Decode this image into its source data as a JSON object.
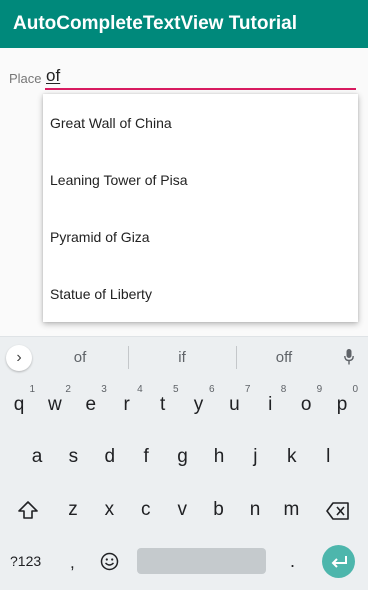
{
  "app": {
    "title": "AutoCompleteTextView Tutorial",
    "accent": "#00897b",
    "underline": "#d81b60"
  },
  "form": {
    "place_label": "Place",
    "place_value": "of"
  },
  "suggestions": [
    "Great Wall of China",
    "Leaning Tower of Pisa",
    "Pyramid of Giza",
    "Statue of Liberty"
  ],
  "keyboard": {
    "strip": {
      "words": [
        "of",
        "if",
        "off"
      ],
      "arrow_icon": "chevron-right-icon",
      "mic_icon": "mic-icon"
    },
    "row1": [
      {
        "c": "q",
        "h": "1"
      },
      {
        "c": "w",
        "h": "2"
      },
      {
        "c": "e",
        "h": "3"
      },
      {
        "c": "r",
        "h": "4"
      },
      {
        "c": "t",
        "h": "5"
      },
      {
        "c": "y",
        "h": "6"
      },
      {
        "c": "u",
        "h": "7"
      },
      {
        "c": "i",
        "h": "8"
      },
      {
        "c": "o",
        "h": "9"
      },
      {
        "c": "p",
        "h": "0"
      }
    ],
    "row2": [
      "a",
      "s",
      "d",
      "f",
      "g",
      "h",
      "j",
      "k",
      "l"
    ],
    "row3": [
      "z",
      "x",
      "c",
      "v",
      "b",
      "n",
      "m"
    ],
    "row4": {
      "symbols": "?123",
      "comma": ",",
      "period": "."
    }
  }
}
